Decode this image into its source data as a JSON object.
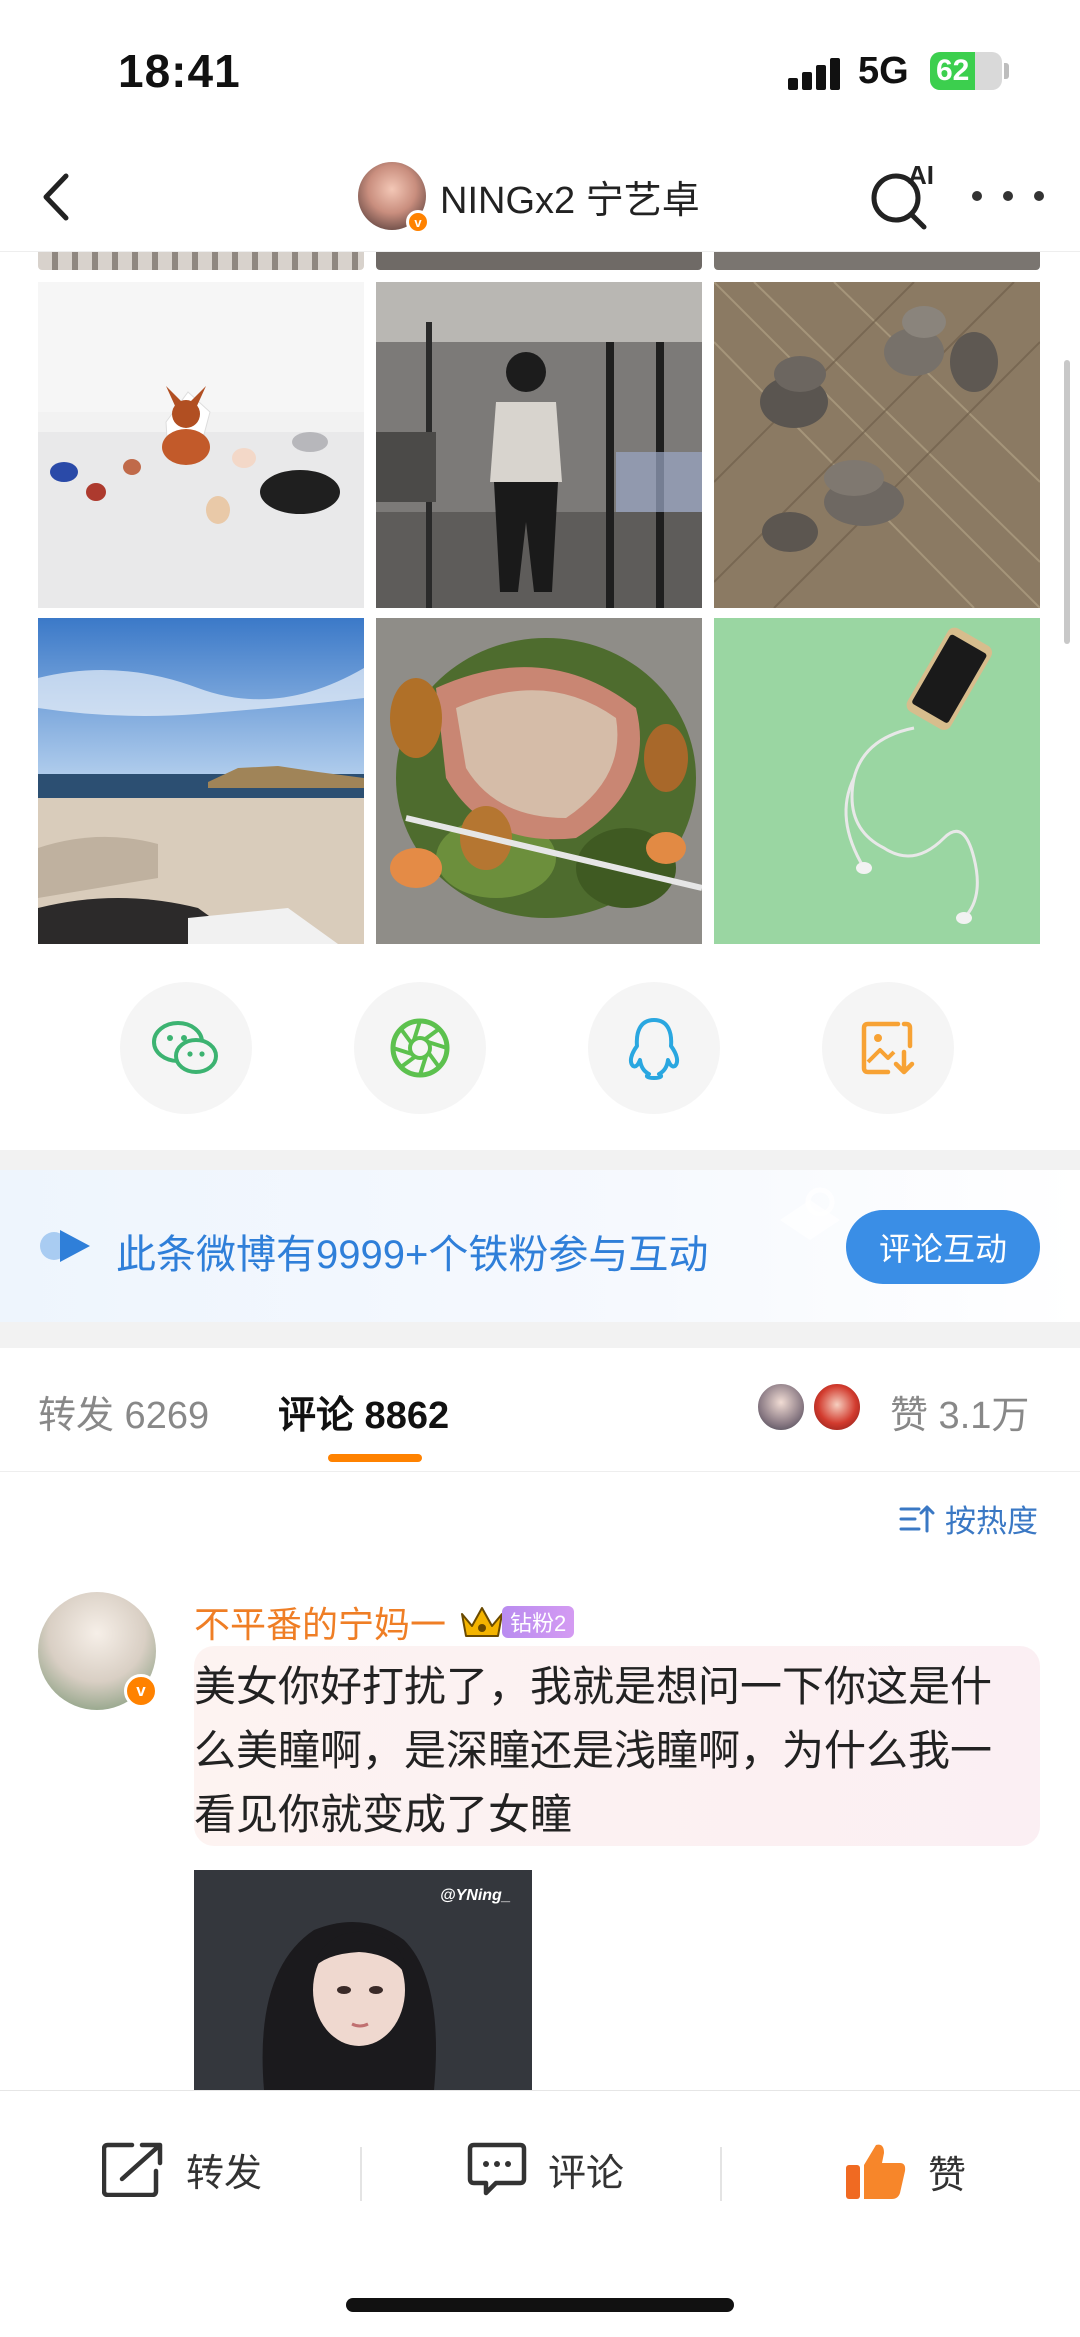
{
  "status_bar": {
    "time": "18:41",
    "network": "5G",
    "battery": "62",
    "battery_level": 0.62
  },
  "header": {
    "title": "NINGx2 宁艺卓",
    "ai_label": "AI"
  },
  "share": {
    "options": [
      "wechat-icon",
      "moments-icon",
      "qq-icon",
      "save-image-icon"
    ]
  },
  "fans_banner": {
    "text": "此条微博有9999+个铁粉参与互动",
    "button": "评论互动"
  },
  "tabs": {
    "repost": "转发 6269",
    "comment": "评论 8862",
    "likes": "赞 3.1万"
  },
  "sort": {
    "label": "按热度"
  },
  "comment": {
    "username": "不平番的宁妈一",
    "badge": "钻粉2",
    "text": "美女你好打扰了，我就是想问一下你这是什么美瞳啊，是深瞳还是浅瞳啊，为什么我一看见你就变成了女瞳",
    "image_watermark": "@YNing_"
  },
  "actions": {
    "repost": "转发",
    "comment": "评论",
    "like": "赞"
  },
  "colors": {
    "accent": "#ff8200",
    "link": "#3a78c4",
    "fans_blue": "#3a8ee6",
    "username": "#ef7e25"
  }
}
